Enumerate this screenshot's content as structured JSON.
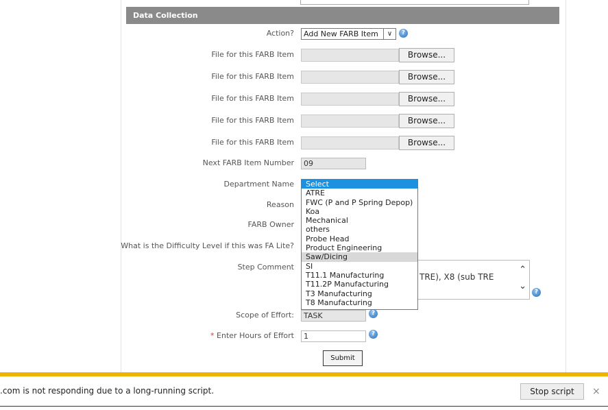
{
  "section_title": "Data Collection",
  "form": {
    "action_label": "Action?",
    "action_value": "Add New FARB Item",
    "file_label": "File for this FARB Item",
    "browse_label": "Browse...",
    "next_item_label": "Next FARB Item Number",
    "next_item_value": "09",
    "department_label": "Department Name",
    "department_options": [
      "Select",
      "ATRE",
      "FWC (P and P Spring Depop)",
      "Koa",
      "Mechanical",
      "others",
      "Probe Head",
      "Product Engineering",
      "Saw/Dicing",
      "SI",
      "T11.1 Manufacturing",
      "T11.2P Manufacturing",
      "T3 Manufacturing",
      "T8 Manufacturing"
    ],
    "department_selected": "Select",
    "department_hovered": "Saw/Dicing",
    "reason_label": "Reason",
    "owner_label": "FARB Owner",
    "difficulty_label": "What is the Difficulty Level if this was FA Lite?",
    "step_comment_label": "Step Comment",
    "step_comment_visible_text": "TRE), X8 (sub TRE",
    "scope_label": "Scope of Effort:",
    "scope_value": "TASK",
    "required_marker": "*",
    "hours_label": "Enter Hours of Effort",
    "hours_value": "1",
    "submit_label": "Submit"
  },
  "notification": {
    "message": ".com is not responding due to a long-running script.",
    "stop_label": "Stop script",
    "close_glyph": "×"
  },
  "colors": {
    "header": "#8a8a8a",
    "notification_accent": "#f0b400",
    "selected_option": "#1e90e0"
  }
}
